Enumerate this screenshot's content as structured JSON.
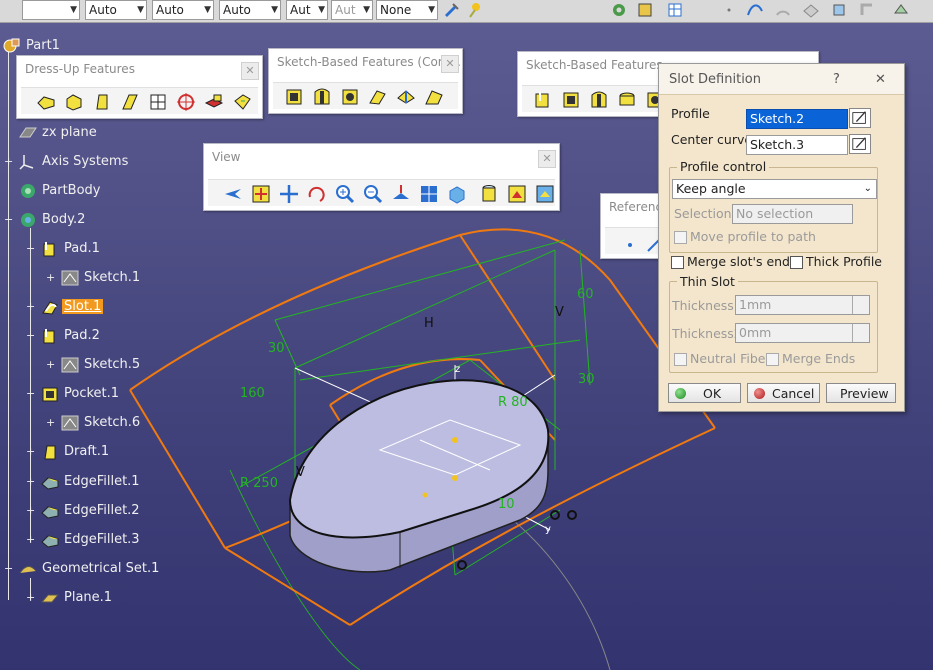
{
  "toolbar_top": {
    "combos": [
      "",
      "Auto",
      "Auto",
      "Auto",
      "Aut",
      "Aut",
      "None"
    ]
  },
  "tree": {
    "nodes": [
      {
        "label": "Part1",
        "icon": "part-icon"
      },
      {
        "label": "zx plane",
        "icon": "plane-icon"
      },
      {
        "label": "Axis Systems",
        "icon": "axis-icon"
      },
      {
        "label": "PartBody",
        "icon": "body-icon"
      },
      {
        "label": "Body.2",
        "icon": "body-icon"
      },
      {
        "label": "Pad.1",
        "icon": "pad-icon"
      },
      {
        "label": "Sketch.1",
        "icon": "sketch-icon"
      },
      {
        "label": "Slot.1",
        "icon": "slot-icon"
      },
      {
        "label": "Pad.2",
        "icon": "pad-icon"
      },
      {
        "label": "Sketch.5",
        "icon": "sketch-icon"
      },
      {
        "label": "Pocket.1",
        "icon": "pocket-icon"
      },
      {
        "label": "Sketch.6",
        "icon": "sketch-icon"
      },
      {
        "label": "Draft.1",
        "icon": "draft-icon"
      },
      {
        "label": "EdgeFillet.1",
        "icon": "fillet-icon"
      },
      {
        "label": "EdgeFillet.2",
        "icon": "fillet-icon"
      },
      {
        "label": "EdgeFillet.3",
        "icon": "fillet-icon"
      },
      {
        "label": "Geometrical Set.1",
        "icon": "geoset-icon"
      },
      {
        "label": "Plane.1",
        "icon": "plane-icon"
      }
    ]
  },
  "toolbars": {
    "dressup": "Dress-Up Features",
    "sketch_com": "Sketch-Based Features (Com...",
    "sketch": "Sketch-Based Features",
    "view": "View",
    "reference": "Reference"
  },
  "viewport": {
    "dims": [
      "30",
      "160",
      "H",
      "60",
      "V",
      "30",
      "R 80",
      "V",
      "R 250",
      "10"
    ]
  },
  "dialog": {
    "title": "Slot Definition",
    "help": "?",
    "close": "✕",
    "profile_label": "Profile",
    "profile_value": "Sketch.2",
    "center_label": "Center curve",
    "center_value": "Sketch.3",
    "profile_control_label": "Profile control",
    "profile_control_value": "Keep angle",
    "selection_label": "Selection:",
    "selection_value": "No selection",
    "move_profile_label": "Move profile to path",
    "merge_label": "Merge slot's ends",
    "thick_label": "Thick Profile",
    "thin_slot_label": "Thin Slot",
    "thickness1_label": "Thickness1:",
    "thickness1_value": "1mm",
    "thickness2_label": "Thickness2:",
    "thickness2_value": "0mm",
    "neutral_label": "Neutral Fiber",
    "merge_ends_label": "Merge Ends",
    "ok_label": "OK",
    "cancel_label": "Cancel",
    "preview_label": "Preview"
  },
  "colors": {
    "accent_orange": "#f29a1f",
    "construction_green": "#22b522",
    "geometry_orange": "#f07a10",
    "solid_face": "#b8b8e0"
  }
}
